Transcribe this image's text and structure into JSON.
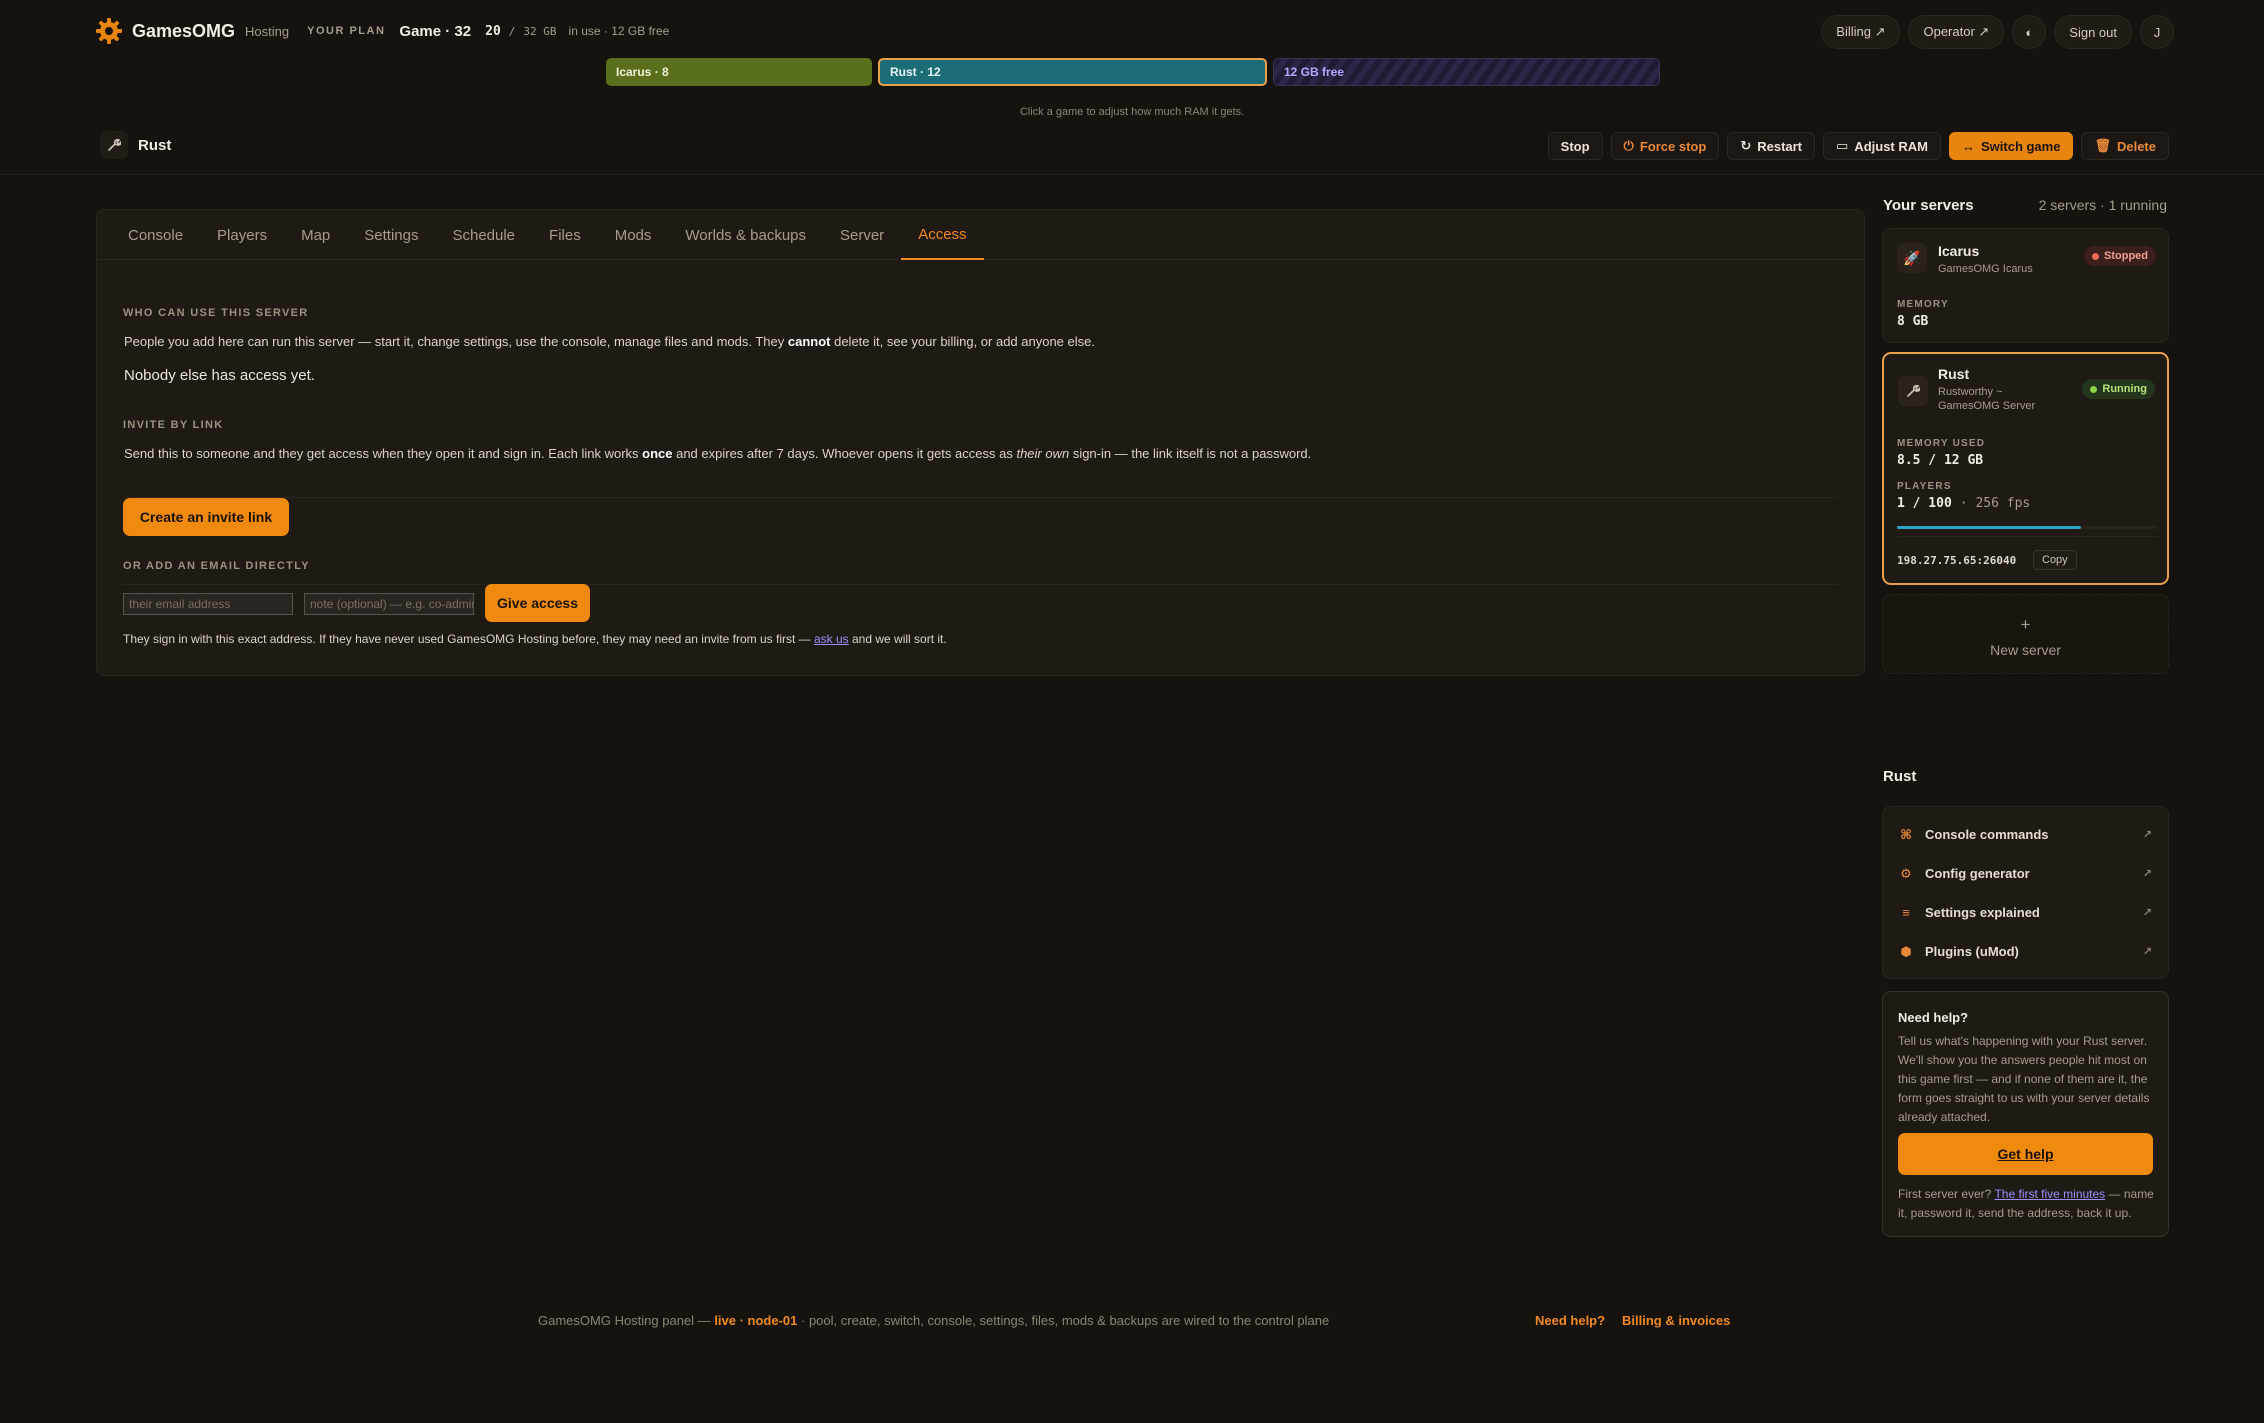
{
  "brand": {
    "name": "GamesOMG",
    "sub": "Hosting"
  },
  "plan": {
    "label": "YOUR PLAN",
    "name": "Game · 32",
    "used": "20",
    "sep": "/",
    "total": "32 GB",
    "note": "in use · 12 GB free"
  },
  "top_nav": {
    "billing": "Billing ↗",
    "operator": "Operator ↗",
    "theme_icon": "contrast-icon",
    "theme_glyph": "◐",
    "sign_out": "Sign out",
    "avatar": "J"
  },
  "ram_bar": {
    "segments": [
      {
        "label": "Icarus · 8",
        "gb": 8,
        "color": "#5a6f1b"
      },
      {
        "label": "Rust · 12",
        "gb": 12,
        "color": "#1d6d77"
      },
      {
        "label": "12 GB free",
        "gb": 12,
        "color": "#201a32"
      }
    ],
    "hint": "Click a game to adjust how much RAM it gets."
  },
  "server_header": {
    "icon": "wrench-icon",
    "icon_glyph": "🔧",
    "name": "Rust"
  },
  "actions": {
    "stop": "Stop",
    "force_stop": "Force stop",
    "restart": "Restart",
    "adjust_ram": "Adjust RAM",
    "switch_game": "Switch game",
    "delete": "Delete"
  },
  "tabs": [
    "Console",
    "Players",
    "Map",
    "Settings",
    "Schedule",
    "Files",
    "Mods",
    "Worlds & backups",
    "Server",
    "Access"
  ],
  "active_tab": "Access",
  "access": {
    "who_label": "WHO CAN USE THIS SERVER",
    "who_text_1": "People you add here can run this server — start it, change settings, use the console, manage files and mods. They ",
    "who_text_bold": "cannot",
    "who_text_2": " delete it, see your billing, or add anyone else.",
    "nobody": "Nobody else has access yet.",
    "invite_label": "INVITE BY LINK",
    "invite_text_1": "Send this to someone and they get access when they open it and sign in. Each link works ",
    "invite_text_bold": "once",
    "invite_text_2": " and expires after 7 days. Whoever opens it gets access as ",
    "invite_text_em": "their own",
    "invite_text_3": " sign-in — the link itself is not a password.",
    "create_invite": "Create an invite link",
    "email_label": "OR ADD AN EMAIL DIRECTLY",
    "email_placeholder": "their email address",
    "note_placeholder": "note (optional) — e.g. co-admin",
    "give_access": "Give access",
    "footnote_1": "They sign in with this exact address. If they have never used GamesOMG Hosting before, they may need an invite from us first — ",
    "footnote_link": "ask us",
    "footnote_2": " and we will sort it."
  },
  "sidebar": {
    "title": "Your servers",
    "meta": "2 servers · 1 running",
    "servers": [
      {
        "name": "Icarus",
        "sub": "GamesOMG Icarus",
        "status": "Stopped",
        "icon": "rocket-icon",
        "mem_label": "MEMORY",
        "mem_value": "8 GB"
      },
      {
        "name": "Rust",
        "sub": "Rustworthy ~ GamesOMG Server",
        "status": "Running",
        "icon": "wrench-icon",
        "mem_label": "MEMORY USED",
        "mem_value": "8.5 / 12 GB",
        "players_label": "PLAYERS",
        "players_value": "1 / 100",
        "players_fps": "· 256 fps",
        "mem_fraction": 0.708,
        "ip": "198.27.75.65:26040",
        "copy": "Copy"
      }
    ],
    "new_server_plus": "+",
    "new_server": "New server",
    "resources_title": "Rust",
    "resources": [
      {
        "label": "Console commands",
        "icon": "command-icon",
        "glyph": "⌘",
        "arrow": "↗"
      },
      {
        "label": "Config generator",
        "icon": "gear-icon",
        "glyph": "⚙",
        "arrow": "↗"
      },
      {
        "label": "Settings explained",
        "icon": "list-icon",
        "glyph": "≡",
        "arrow": "↗"
      },
      {
        "label": "Plugins (uMod)",
        "icon": "plugin-icon",
        "glyph": "⬢",
        "arrow": "↗"
      }
    ],
    "help": {
      "title": "Need help?",
      "text": "Tell us what's happening with your Rust server. We'll show you the answers people hit most on this game first — and if none of them are it, the form goes straight to us with your server details already attached.",
      "button": "Get help",
      "first_1": "First server ever? ",
      "first_link": "The first five minutes",
      "first_2": " — name it, password it, send the address, back it up."
    }
  },
  "footer": {
    "prefix": "GamesOMG Hosting panel —",
    "live": "live · node-01",
    "suffix": "· pool, create, switch, console, settings, files, mods & backups are wired to the control plane",
    "need_help": "Need help?",
    "billing": "Billing & invoices"
  },
  "colors": {
    "accent": "#f08a22",
    "background": "#16120d",
    "running": "#8fd14a",
    "stopped": "#f06a5a"
  }
}
